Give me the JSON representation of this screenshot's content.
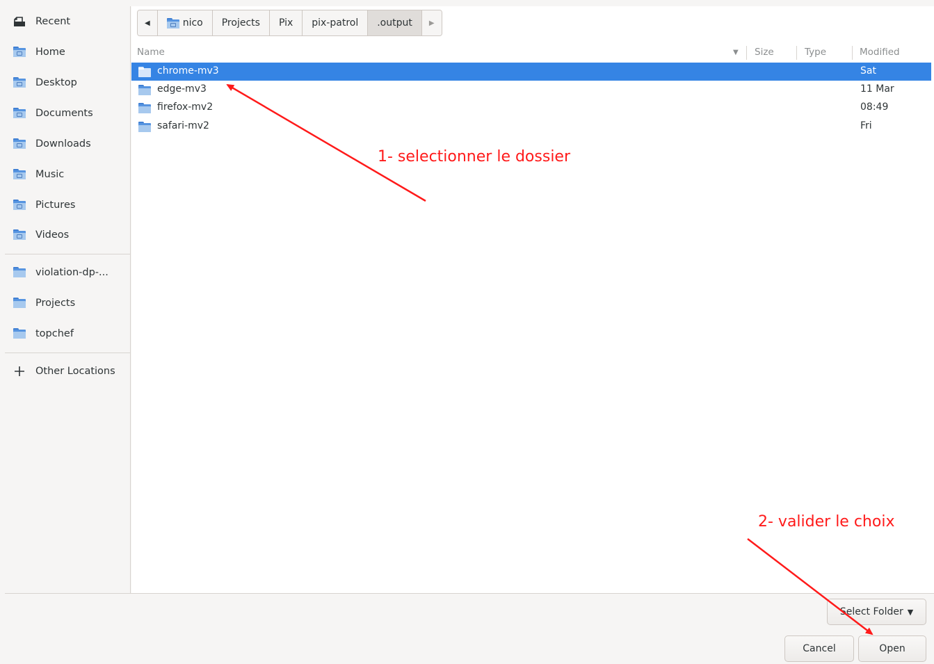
{
  "sidebar": {
    "items": [
      {
        "label": "Recent",
        "icon": "recent-icon"
      },
      {
        "label": "Home",
        "icon": "home-folder-icon"
      },
      {
        "label": "Desktop",
        "icon": "desktop-folder-icon"
      },
      {
        "label": "Documents",
        "icon": "documents-folder-icon"
      },
      {
        "label": "Downloads",
        "icon": "downloads-folder-icon"
      },
      {
        "label": "Music",
        "icon": "music-folder-icon"
      },
      {
        "label": "Pictures",
        "icon": "pictures-folder-icon"
      },
      {
        "label": "Videos",
        "icon": "videos-folder-icon"
      }
    ],
    "bookmarks": [
      {
        "label": "violation-dp-...",
        "icon": "folder-icon"
      },
      {
        "label": "Projects",
        "icon": "folder-icon"
      },
      {
        "label": "topchef",
        "icon": "folder-icon"
      }
    ],
    "other_locations": {
      "label": "Other Locations",
      "icon": "plus-icon"
    }
  },
  "pathbar": {
    "crumbs": [
      "nico",
      "Projects",
      "Pix",
      "pix-patrol",
      ".output"
    ],
    "active": ".output"
  },
  "columns": {
    "name": "Name",
    "size": "Size",
    "type": "Type",
    "modified": "Modified"
  },
  "files": [
    {
      "name": "chrome-mv3",
      "modified": "Sat",
      "selected": true
    },
    {
      "name": "edge-mv3",
      "modified": "11 Mar",
      "selected": false
    },
    {
      "name": "firefox-mv2",
      "modified": "08:49",
      "selected": false
    },
    {
      "name": "safari-mv2",
      "modified": "Fri",
      "selected": false
    }
  ],
  "footer": {
    "select_folder_label": "Select Folder",
    "cancel_label": "Cancel",
    "open_label": "Open"
  },
  "annotations": {
    "step1": "1- selectionner le dossier",
    "step2": "2- valider le choix",
    "color": "#ff1a1a"
  },
  "colors": {
    "selection": "#3584e4",
    "folder": "#5694e0"
  }
}
